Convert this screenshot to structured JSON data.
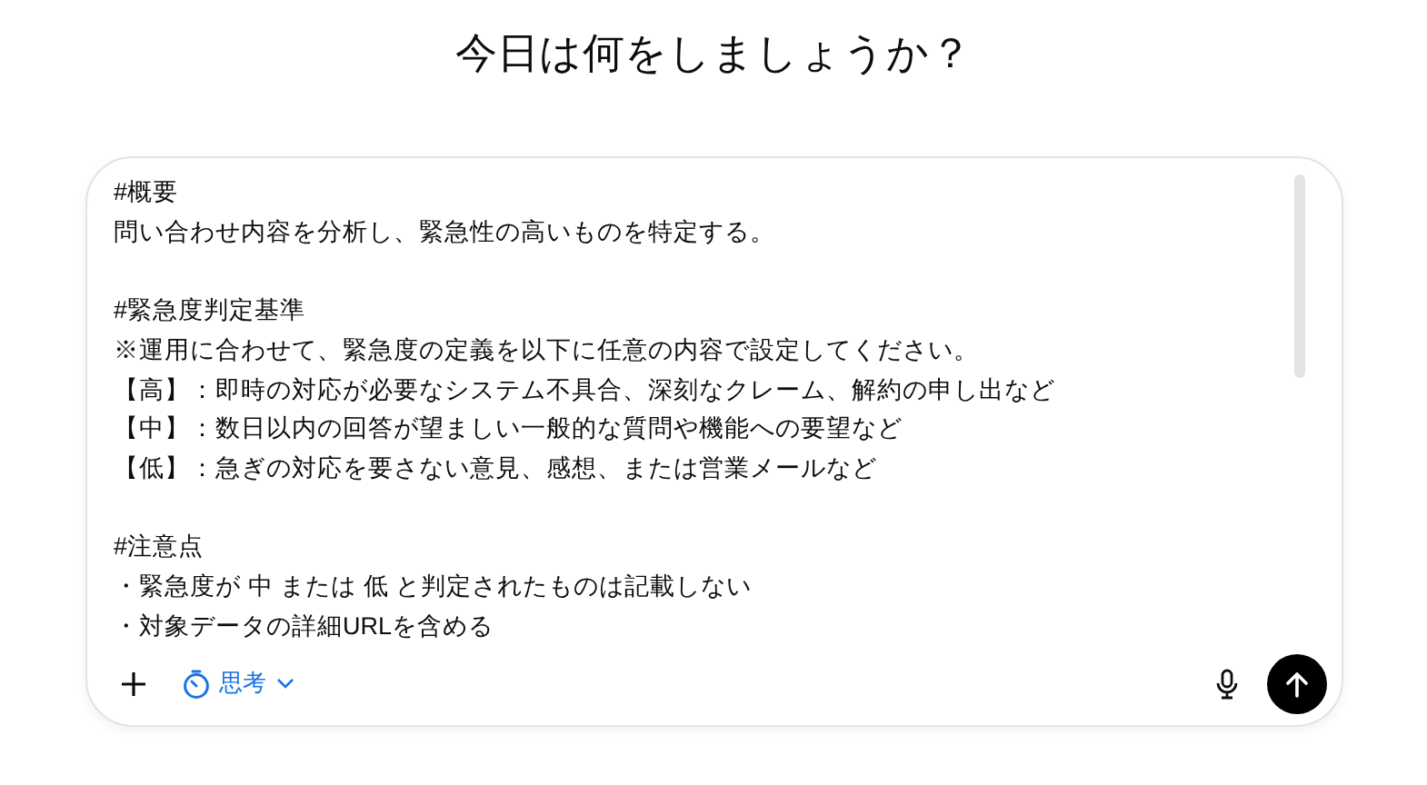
{
  "heading": "今日は何をしましょうか？",
  "composer": {
    "blocks": [
      [
        "#概要",
        "問い合わせ内容を分析し、緊急性の高いものを特定する。"
      ],
      [
        "#緊急度判定基準",
        "※運用に合わせて、緊急度の定義を以下に任意の内容で設定してください。",
        "【高】：即時の対応が必要なシステム不具合、深刻なクレーム、解約の申し出など",
        "【中】：数日以内の回答が望ましい一般的な質問や機能への要望など",
        "【低】：急ぎの対応を要さない意見、感想、または営業メールなど"
      ],
      [
        "#注意点",
        "・緊急度が 中 または 低 と判定されたものは記載しない",
        "・対象データの詳細URLを含める"
      ]
    ],
    "mode": "思考"
  }
}
